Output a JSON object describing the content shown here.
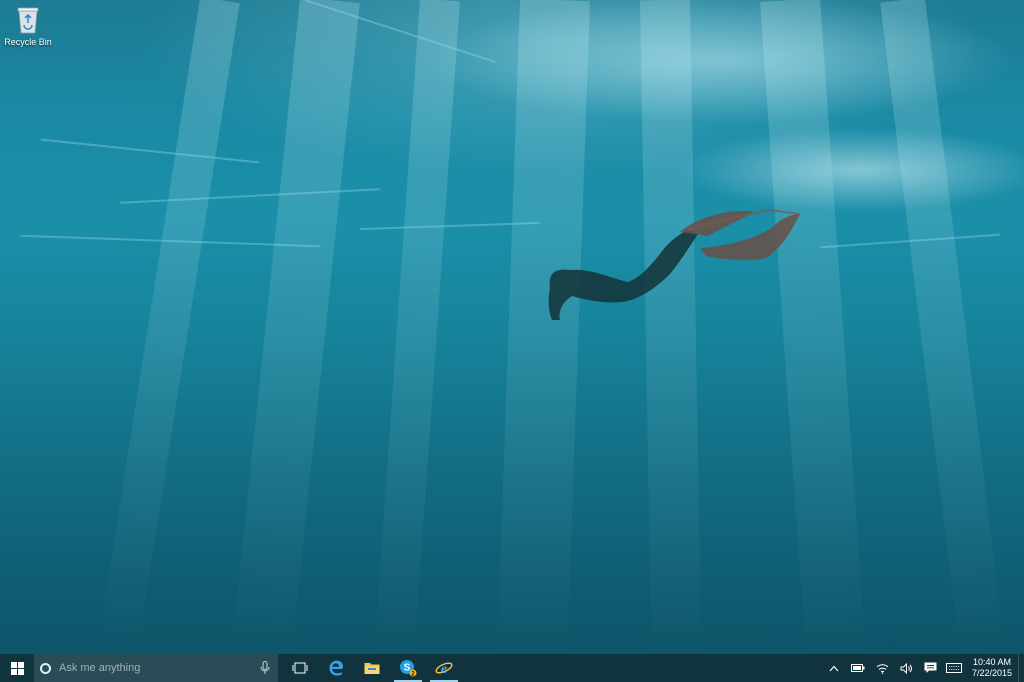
{
  "desktop": {
    "icons": [
      {
        "label": "Recycle Bin",
        "icon": "recycle-bin-icon"
      }
    ]
  },
  "taskbar": {
    "start_icon": "windows-logo-icon",
    "search": {
      "placeholder": "Ask me anything",
      "icon": "cortana-circle-icon",
      "mic_icon": "microphone-icon"
    },
    "apps": [
      {
        "name": "task-view",
        "icon": "task-view-icon",
        "active": false
      },
      {
        "name": "microsoft-edge",
        "icon": "edge-icon",
        "active": false
      },
      {
        "name": "file-explorer",
        "icon": "folder-icon",
        "active": false
      },
      {
        "name": "skype",
        "icon": "skype-icon",
        "active": true,
        "badge": "2"
      },
      {
        "name": "internet-explorer",
        "icon": "internet-explorer-icon",
        "active": true
      }
    ],
    "tray": {
      "icons": [
        "chevron-up-icon",
        "battery-icon",
        "wifi-icon",
        "volume-icon",
        "action-center-icon",
        "keyboard-icon"
      ],
      "time": "10:40 AM",
      "date": "7/22/2015"
    }
  },
  "colors": {
    "taskbar": "#10333d",
    "search_box": "#2b4c56",
    "accent": "#1f86d6"
  }
}
